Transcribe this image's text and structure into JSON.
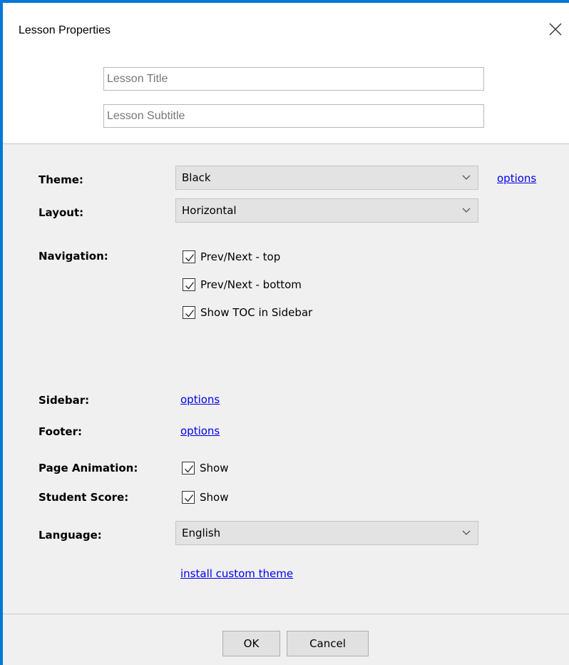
{
  "window": {
    "title": "Lesson Properties"
  },
  "header": {
    "title_placeholder": "Lesson Title",
    "subtitle_placeholder": "Lesson Subtitle",
    "title_value": "",
    "subtitle_value": ""
  },
  "form": {
    "theme": {
      "label": "Theme:",
      "value": "Black",
      "link": "options"
    },
    "layout": {
      "label": "Layout:",
      "value": "Horizontal"
    },
    "navigation": {
      "label": "Navigation:",
      "options": [
        {
          "label": "Prev/Next - top",
          "checked": true
        },
        {
          "label": "Prev/Next - bottom",
          "checked": true
        },
        {
          "label": "Show TOC in Sidebar",
          "checked": true
        }
      ]
    },
    "sidebar": {
      "label": "Sidebar:",
      "link": "options"
    },
    "footer": {
      "label": "Footer:",
      "link": "options"
    },
    "page_animation": {
      "label": "Page Animation:",
      "option": "Show",
      "checked": true
    },
    "student_score": {
      "label": "Student Score:",
      "option": "Show",
      "checked": true
    },
    "language": {
      "label": "Language:",
      "value": "English"
    },
    "install_link": "install custom theme"
  },
  "buttons": {
    "ok": "OK",
    "cancel": "Cancel"
  },
  "colors": {
    "accent": "#0078d7",
    "link": "#0000ee",
    "panel": "#f0f0f0"
  }
}
